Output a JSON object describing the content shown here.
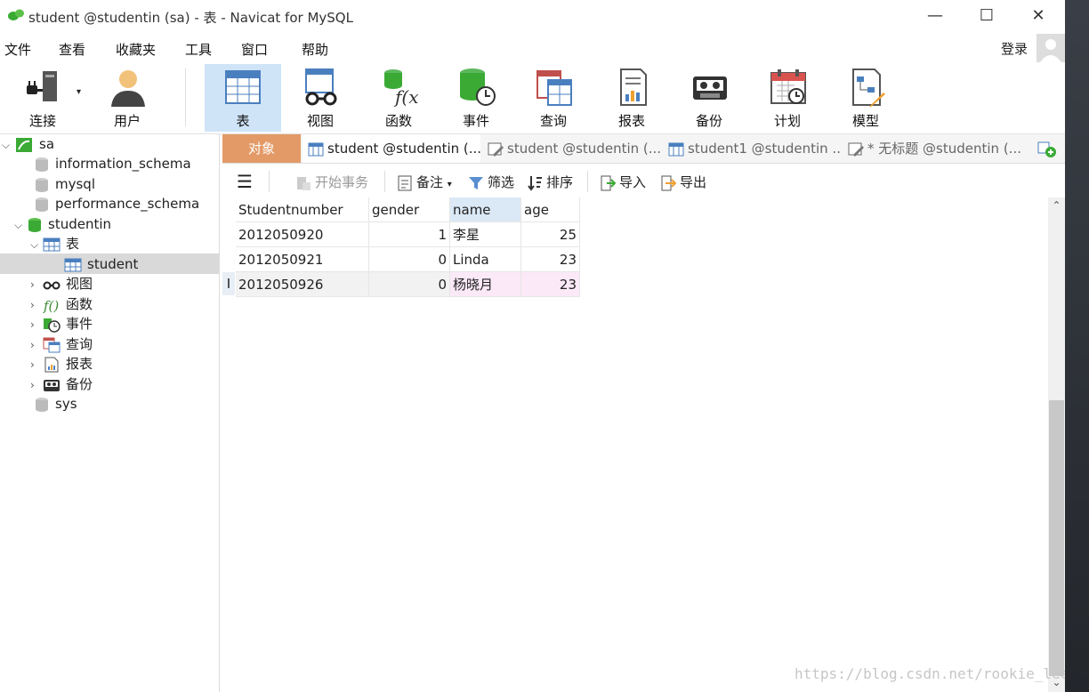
{
  "window": {
    "title": "student @studentin (sa) - 表 - Navicat for MySQL",
    "controls": {
      "minimize": "—",
      "maximize": "☐",
      "close": "✕"
    }
  },
  "menu": {
    "items": [
      "文件",
      "查看",
      "收藏夹",
      "工具",
      "窗口",
      "帮助"
    ],
    "login": "登录"
  },
  "toolbar": {
    "items": [
      {
        "label": "连接",
        "icon": "plug-icon"
      },
      {
        "label": "用户",
        "icon": "user-icon"
      },
      {
        "label": "表",
        "icon": "table-icon"
      },
      {
        "label": "视图",
        "icon": "view-glasses-icon"
      },
      {
        "label": "函数",
        "icon": "function-icon"
      },
      {
        "label": "事件",
        "icon": "event-clock-icon"
      },
      {
        "label": "查询",
        "icon": "query-icon"
      },
      {
        "label": "报表",
        "icon": "report-icon"
      },
      {
        "label": "备份",
        "icon": "backup-tape-icon"
      },
      {
        "label": "计划",
        "icon": "calendar-icon"
      },
      {
        "label": "模型",
        "icon": "model-icon"
      }
    ],
    "active": "表"
  },
  "sidebar": {
    "connection": "sa",
    "databases": [
      "information_schema",
      "mysql",
      "performance_schema",
      "studentin",
      "sys"
    ],
    "studentin_children": {
      "tables_group": "表",
      "table": "student",
      "groups": [
        "视图",
        "函数",
        "事件",
        "查询",
        "报表",
        "备份"
      ]
    }
  },
  "tabs": {
    "object": "对象",
    "items": [
      "student @studentin (...",
      "student @studentin (...",
      "student1 @studentin ...",
      "* 无标题 @studentin (..."
    ]
  },
  "subtoolbar": {
    "begin_transaction": "开始事务",
    "note": "备注",
    "filter": "筛选",
    "sort": "排序",
    "import": "导入",
    "export": "导出"
  },
  "grid": {
    "columns": [
      "Studentnumber",
      "gender",
      "name",
      "age"
    ],
    "rows": [
      [
        "2012050920",
        "1",
        "李星",
        "25"
      ],
      [
        "2012050921",
        "0",
        "Linda",
        "23"
      ],
      [
        "2012050926",
        "0",
        "杨晓月",
        "23"
      ]
    ],
    "row_cursor": "I"
  },
  "watermark": "https://blog.csdn.net/rookie_lee",
  "colors": {
    "object_tab": "#e39a66",
    "active_tool": "#cfe4f7",
    "db_green": "#3aaa35"
  }
}
